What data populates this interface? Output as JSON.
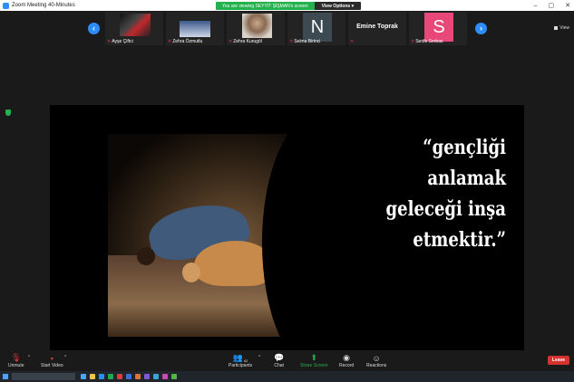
{
  "window": {
    "title": "Zoom Meeting 40-Minutes",
    "controls": [
      "–",
      "▢",
      "✕"
    ]
  },
  "banner": {
    "viewing": "You are viewing SEYYİT ŞİŞMAN's screen",
    "options": "View Options ▾"
  },
  "strip": {
    "view_label": "View",
    "participants": [
      {
        "name": "Ayşe Çiftci",
        "type": "video"
      },
      {
        "name": "Zehra Özmutlu",
        "type": "video"
      },
      {
        "name": "Zehra Kurugöl",
        "type": "video"
      },
      {
        "name": "Selma Birinci",
        "type": "letter",
        "letter": "N",
        "bg": "#3d4a52"
      },
      {
        "name": "Emine Toprak",
        "type": "text"
      },
      {
        "name": "Serife Serbas",
        "type": "letter",
        "letter": "S",
        "bg": "#e8477a"
      }
    ]
  },
  "slide": {
    "quote_lines": [
      "“gençliği",
      "anlamak",
      "geleceği inşa",
      "etmektir.”"
    ]
  },
  "toolbar": {
    "unmute": "Unmute",
    "start_video": "Start Video",
    "participants": "Participants",
    "participants_count": "62",
    "chat": "Chat",
    "share_screen": "Share Screen",
    "record": "Record",
    "reactions": "Reactions",
    "leave": "Leave"
  },
  "colors": {
    "accent": "#2d8cff",
    "banner_green": "#23b14d",
    "leave_red": "#d5322e",
    "muted_red": "#e0393e"
  }
}
